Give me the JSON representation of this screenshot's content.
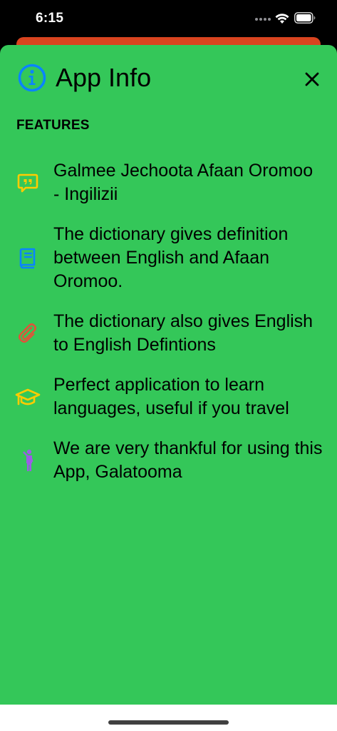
{
  "status_bar": {
    "time": "6:15"
  },
  "header": {
    "title": "App Info",
    "icon": "info-circle-icon",
    "close_icon": "close-icon"
  },
  "features": {
    "section_title": "FEATURES",
    "items": [
      {
        "icon": "quote-bubble-icon",
        "color": "#ffcc00",
        "text": "Galmee Jechoota Afaan Oromoo - Ingilizii"
      },
      {
        "icon": "book-icon",
        "color": "#0a84ff",
        "text": "The dictionary gives definition between English and Afaan Oromoo."
      },
      {
        "icon": "paperclip-icon",
        "color": "#e0533a",
        "text": "The dictionary also gives English to English Defintions"
      },
      {
        "icon": "graduation-cap-icon",
        "color": "#ffcc00",
        "text": "Perfect application to learn languages, useful if you travel"
      },
      {
        "icon": "waving-person-icon",
        "color": "#9b5de5",
        "text": "We are very thankful for using this App, Galatooma"
      }
    ]
  },
  "colors": {
    "sheet_background": "#34c759",
    "background_sheet_peek": "#d9441f",
    "info_icon": "#0a84ff"
  }
}
